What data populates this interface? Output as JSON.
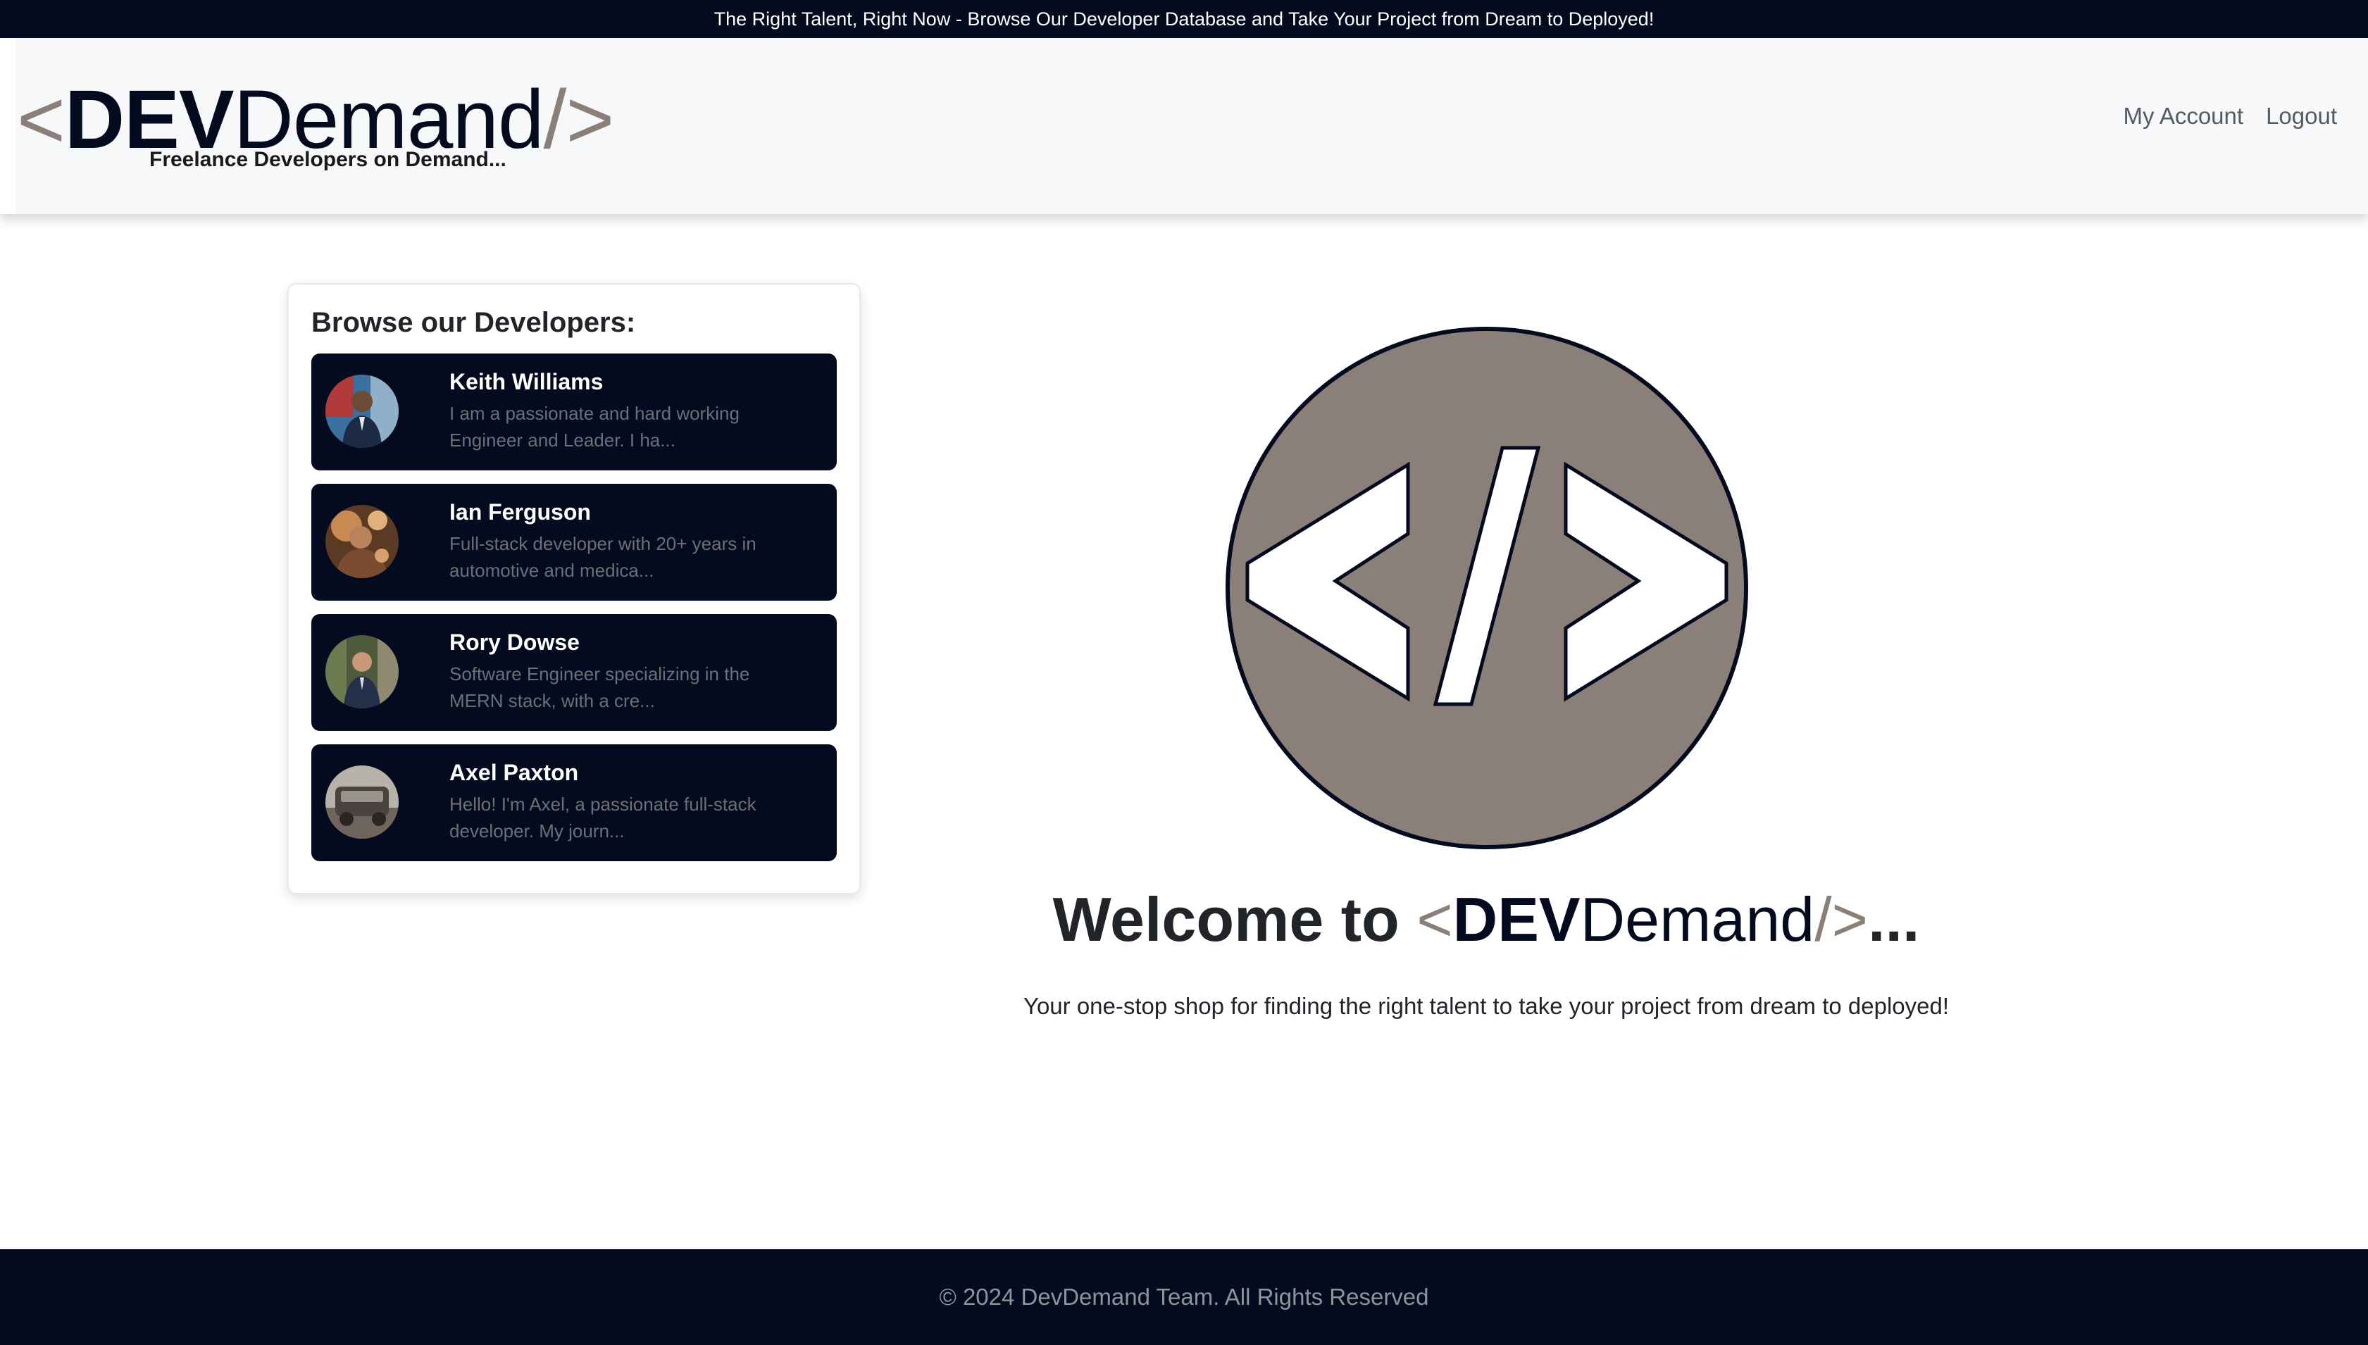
{
  "announcement": "The Right Talent, Right Now - Browse Our Developer Database and Take Your Project from Dream to Deployed!",
  "brand": {
    "open_bracket": "<",
    "dev": "DEV",
    "demand": "Demand",
    "close_bracket": "/>",
    "tagline": "Freelance Developers on Demand..."
  },
  "nav": {
    "my_account": "My Account",
    "logout": "Logout"
  },
  "browse": {
    "title": "Browse our Developers:",
    "developers": [
      {
        "name": "Keith Williams",
        "description": "I am a passionate and hard working Engineer and Leader. I ha..."
      },
      {
        "name": "Ian Ferguson",
        "description": "Full-stack developer with 20+ years in automotive and medica..."
      },
      {
        "name": "Rory Dowse",
        "description": "Software Engineer specializing in the MERN stack, with a cre..."
      },
      {
        "name": "Axel Paxton",
        "description": "Hello! I'm Axel, a passionate full-stack developer. My journ..."
      }
    ]
  },
  "hero": {
    "icon": "code-brackets-icon",
    "welcome_prefix": "Welcome to",
    "welcome_suffix": "...",
    "subtext": "Your one-stop shop for finding the right talent to take your project from dream to deployed!"
  },
  "footer": {
    "copyright": "© 2024 DevDemand Team. All Rights Reserved"
  },
  "colors": {
    "navy": "#040b1f",
    "brand_taupe": "#8b8079",
    "header_bg": "#f7f8fa"
  }
}
